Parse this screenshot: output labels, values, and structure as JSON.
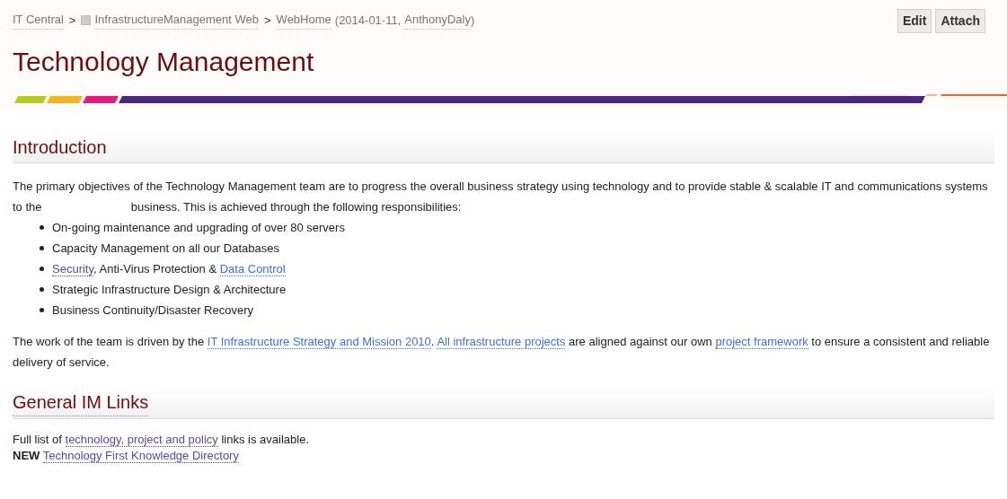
{
  "breadcrumb": [
    {
      "kind": "link",
      "text": "IT Central"
    },
    {
      "kind": "sep",
      "text": ">"
    },
    {
      "kind": "web",
      "text": "InfrastructureManagement Web"
    },
    {
      "kind": "sep",
      "text": ">"
    },
    {
      "kind": "link",
      "text": "WebHome"
    },
    {
      "kind": "text",
      "text": "(2014-01-11,"
    },
    {
      "kind": "link",
      "text": "AnthonyDaly"
    },
    {
      "kind": "text",
      "text": ")"
    }
  ],
  "buttons": [
    {
      "label": "Edit"
    },
    {
      "label": "Attach"
    }
  ],
  "title": "Technology Management",
  "sections": [
    {
      "heading": "Introduction",
      "heading_link": false,
      "blocks": [
        {
          "kind": "paragraph",
          "segments": [
            {
              "kind": "text",
              "text": "The primary objectives of the Technology Management team are to progress the overall business strategy using technology and to provide stable & scalable IT and communications systems to the"
            },
            {
              "kind": "redacted"
            },
            {
              "kind": "text",
              "text": "business. This is achieved through the following responsibilities:"
            }
          ]
        },
        {
          "kind": "list",
          "items": [
            [
              {
                "kind": "text",
                "text": "On-going maintenance and upgrading of over 80 servers"
              }
            ],
            [
              {
                "kind": "text",
                "text": "Capacity Management on all our Databases"
              }
            ],
            [
              {
                "kind": "link",
                "visited": true,
                "text": "Security"
              },
              {
                "kind": "text",
                "text": ", Anti-Virus Protection &"
              },
              {
                "kind": "link",
                "visited": false,
                "text": "Data Control"
              }
            ],
            [
              {
                "kind": "text",
                "text": "Strategic Infrastructure Design & Architecture"
              }
            ],
            [
              {
                "kind": "text",
                "text": "Business Continuity/Disaster Recovery"
              }
            ]
          ]
        },
        {
          "kind": "paragraph",
          "segments": [
            {
              "kind": "text",
              "text": "The work of the team is driven by the"
            },
            {
              "kind": "link",
              "visited": false,
              "text": "IT Infrastructure Strategy and Mission 2010"
            },
            {
              "kind": "text",
              "text": "."
            },
            {
              "kind": "link",
              "visited": false,
              "text": "All infrastructure projects"
            },
            {
              "kind": "text",
              "text": "are aligned against our own"
            },
            {
              "kind": "link",
              "visited": false,
              "text": "project framework"
            },
            {
              "kind": "text",
              "text": "to ensure a consistent and reliable delivery of service."
            }
          ]
        }
      ]
    },
    {
      "heading": "General IM Links",
      "heading_link": true,
      "blocks": [
        {
          "kind": "line",
          "segments": [
            {
              "kind": "text",
              "text": "Full list of"
            },
            {
              "kind": "link",
              "visited": true,
              "text": "technology, project and policy"
            },
            {
              "kind": "text",
              "text": "links is available."
            }
          ]
        },
        {
          "kind": "line",
          "segments": [
            {
              "kind": "strong",
              "text": "NEW"
            },
            {
              "kind": "link",
              "visited": true,
              "text": "Technology First Knowledge Directory"
            }
          ]
        }
      ]
    }
  ]
}
